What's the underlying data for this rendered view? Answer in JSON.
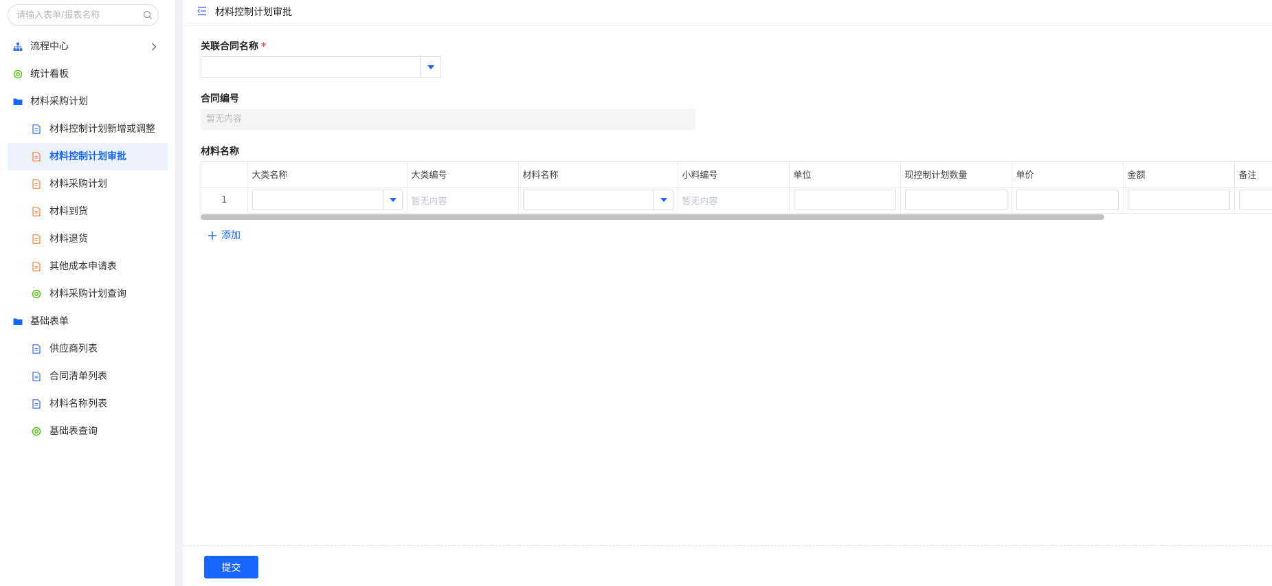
{
  "sidebar": {
    "search_placeholder": "请输入表单/报表名称",
    "items": [
      {
        "label": "流程中心",
        "icon": "org-chart-icon"
      },
      {
        "label": "统计看板",
        "icon": "report-circle-icon"
      },
      {
        "label": "材料采购计划",
        "icon": "folder-icon"
      },
      {
        "label": "材料控制计划新增或调整",
        "icon": "form-doc-icon"
      },
      {
        "label": "材料控制计划审批",
        "icon": "process-doc-icon"
      },
      {
        "label": "材料采购计划",
        "icon": "process-doc-icon"
      },
      {
        "label": "材料到货",
        "icon": "process-doc-icon"
      },
      {
        "label": "材料退货",
        "icon": "process-doc-icon"
      },
      {
        "label": "其他成本申请表",
        "icon": "process-doc-icon"
      },
      {
        "label": "材料采购计划查询",
        "icon": "report-circle-icon"
      },
      {
        "label": "基础表单",
        "icon": "folder-icon"
      },
      {
        "label": "供应商列表",
        "icon": "form-doc-icon"
      },
      {
        "label": "合同清单列表",
        "icon": "form-doc-icon"
      },
      {
        "label": "材料名称列表",
        "icon": "form-doc-icon"
      },
      {
        "label": "基础表查询",
        "icon": "report-circle-icon"
      }
    ]
  },
  "header": {
    "title": "材料控制计划审批"
  },
  "form": {
    "contract_name_label": "关联合同名称",
    "required_mark": "*",
    "contract_name_value": "",
    "contract_no_label": "合同编号",
    "contract_no_value": "暂无内容",
    "material_label": "材料名称",
    "add_label": "添加",
    "submit_label": "提交"
  },
  "table": {
    "columns": [
      "",
      "大类名称",
      "大类编号",
      "材料名称",
      "小料编号",
      "单位",
      "现控制计划数量",
      "单价",
      "金额",
      "备注"
    ],
    "rows": [
      {
        "index": "1",
        "category_no": "暂无内容",
        "sub_no": "暂无内容"
      }
    ]
  },
  "colors": {
    "accent": "#1766ff",
    "active_bg": "#ecf3ff",
    "process_icon": "#ff7a2e",
    "report_icon": "#52c41a"
  }
}
